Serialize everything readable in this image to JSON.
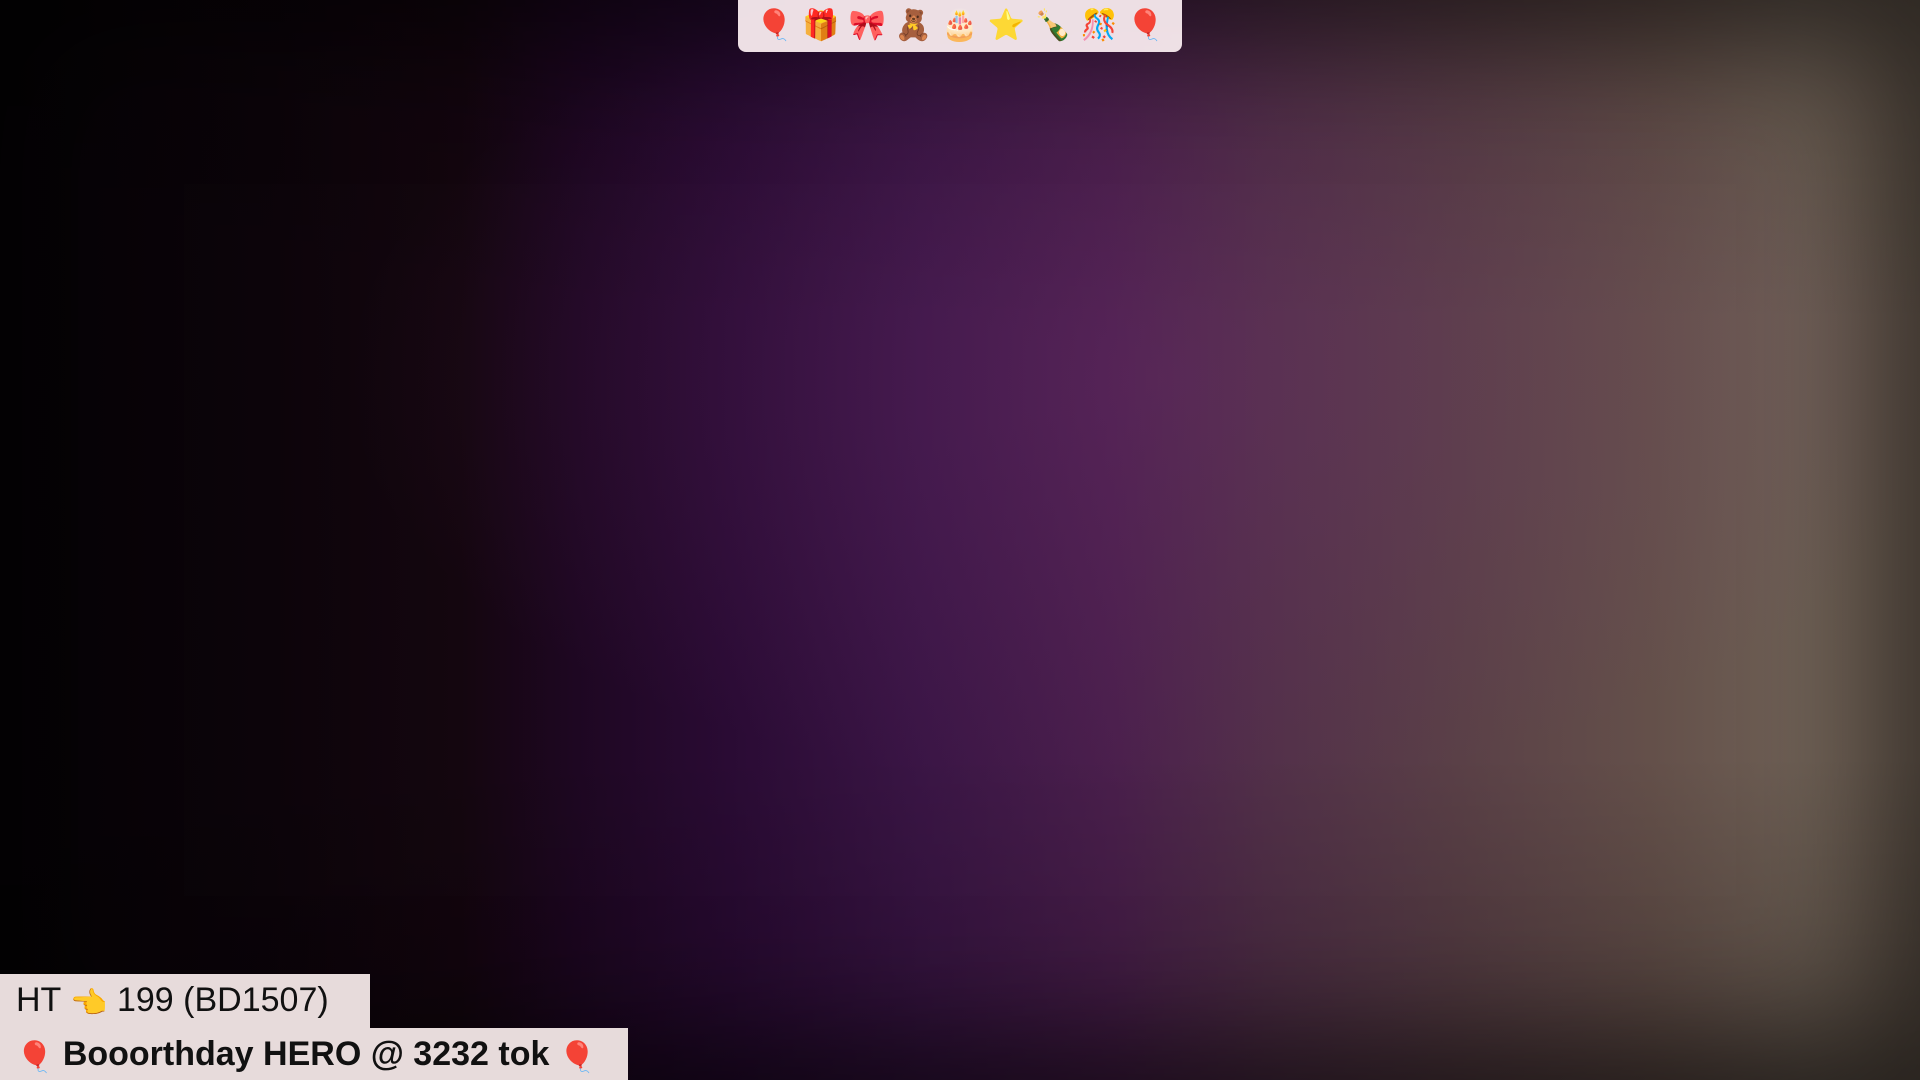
{
  "stream": {
    "background_colors": [
      "#050205",
      "#2a0b34",
      "#4a1f4c",
      "#736457"
    ]
  },
  "emoji_bar": {
    "items": [
      {
        "name": "balloon-icon",
        "glyph": "🎈"
      },
      {
        "name": "gift-icon",
        "glyph": "🎁"
      },
      {
        "name": "ribbon-icon",
        "glyph": "🎀"
      },
      {
        "name": "teddy-bear-icon",
        "glyph": "🧸"
      },
      {
        "name": "birthday-cake-icon",
        "glyph": "🎂"
      },
      {
        "name": "star-icon",
        "glyph": "⭐"
      },
      {
        "name": "champagne-icon",
        "glyph": "🍾"
      },
      {
        "name": "confetti-ball-icon",
        "glyph": "🎊"
      },
      {
        "name": "balloon-icon",
        "glyph": "🎈"
      }
    ]
  },
  "overlay": {
    "line1": {
      "prefix": "HT",
      "icon": "👈",
      "text": "199 (BD1507)"
    },
    "line2": {
      "icon_left": "🎈",
      "text": "Booorthday HERO @ 3232 tok",
      "icon_right": "🎈"
    },
    "colors": {
      "panel_bg": "#eee2e2",
      "text": "#111111",
      "balloon": "#e0203a"
    }
  }
}
